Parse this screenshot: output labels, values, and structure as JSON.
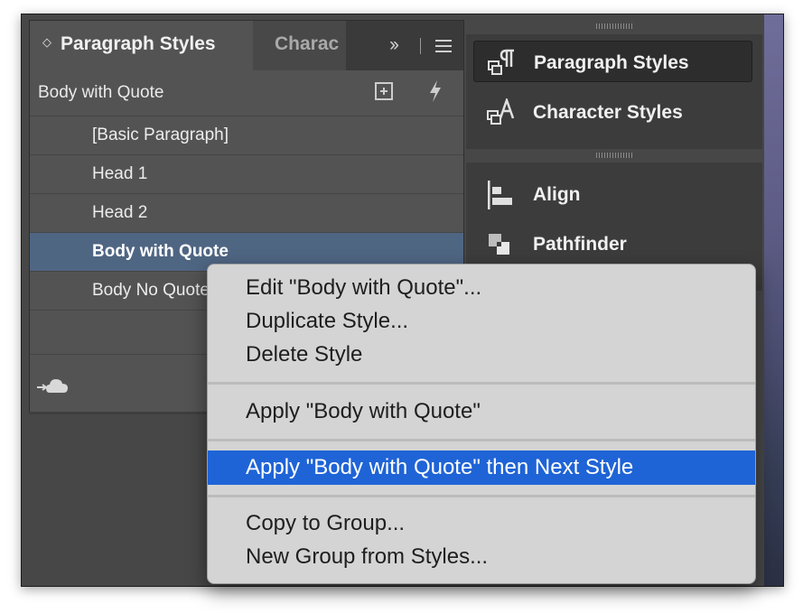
{
  "tabs": {
    "active_label": "Paragraph Styles",
    "inactive_label": "Charac"
  },
  "panel": {
    "current_style": "Body with Quote",
    "styles": [
      {
        "label": "[Basic Paragraph]",
        "selected": false
      },
      {
        "label": "Head 1",
        "selected": false
      },
      {
        "label": "Head 2",
        "selected": false
      },
      {
        "label": "Body with Quote",
        "selected": true
      },
      {
        "label": "Body No Quote",
        "selected": false
      }
    ]
  },
  "dock": {
    "items": [
      {
        "label": "Paragraph Styles",
        "icon": "paragraph-styles-icon",
        "active": true
      },
      {
        "label": "Character Styles",
        "icon": "character-styles-icon",
        "active": false
      },
      {
        "label": "Align",
        "icon": "align-icon",
        "active": false
      },
      {
        "label": "Pathfinder",
        "icon": "pathfinder-icon",
        "active": false
      }
    ]
  },
  "context_menu": {
    "items": [
      {
        "label": "Edit \"Body with Quote\"...",
        "highlighted": false
      },
      {
        "label": "Duplicate Style...",
        "highlighted": false
      },
      {
        "label": "Delete Style",
        "highlighted": false
      },
      {
        "label": "Apply \"Body with Quote\"",
        "highlighted": false
      },
      {
        "label": "Apply \"Body with Quote\" then Next Style",
        "highlighted": true
      },
      {
        "label": "Copy to Group...",
        "highlighted": false
      },
      {
        "label": "New Group from Styles...",
        "highlighted": false
      }
    ]
  },
  "colors": {
    "panel_bg": "#535353",
    "selection": "#4f6683",
    "menu_highlight": "#1f64d6",
    "menu_bg": "#d4d4d4"
  }
}
